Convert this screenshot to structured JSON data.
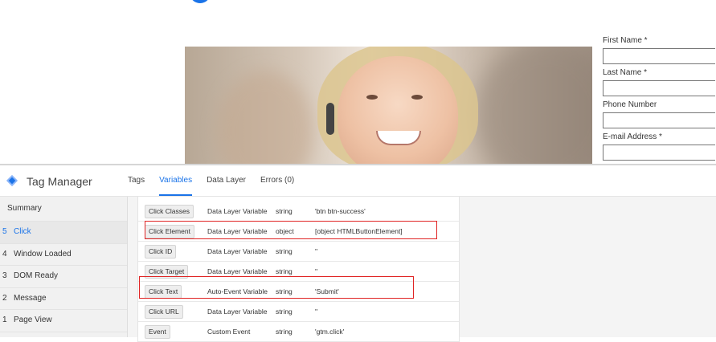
{
  "website": {
    "form": {
      "fields": [
        {
          "label": "First Name *",
          "value": ""
        },
        {
          "label": "Last Name *",
          "value": ""
        },
        {
          "label": "Phone Number",
          "value": ""
        },
        {
          "label": "E-mail Address *",
          "value": ""
        }
      ]
    }
  },
  "gtm": {
    "title": "Tag Manager",
    "tabs": [
      {
        "label": "Tags",
        "active": false
      },
      {
        "label": "Variables",
        "active": true
      },
      {
        "label": "Data Layer",
        "active": false
      },
      {
        "label": "Errors (0)",
        "active": false
      }
    ],
    "sidebar": {
      "summary": "Summary",
      "events": [
        {
          "num": "5",
          "label": "Click",
          "active": true
        },
        {
          "num": "4",
          "label": "Window Loaded",
          "active": false
        },
        {
          "num": "3",
          "label": "DOM Ready",
          "active": false
        },
        {
          "num": "2",
          "label": "Message",
          "active": false
        },
        {
          "num": "1",
          "label": "Page View",
          "active": false
        }
      ]
    },
    "variables": [
      {
        "name": "Click Classes",
        "type": "Data Layer Variable",
        "return_type": "string",
        "value": "'btn btn-success'"
      },
      {
        "name": "Click Element",
        "type": "Data Layer Variable",
        "return_type": "object",
        "value": "[object HTMLButtonElement]"
      },
      {
        "name": "Click ID",
        "type": "Data Layer Variable",
        "return_type": "string",
        "value": "''"
      },
      {
        "name": "Click Target",
        "type": "Data Layer Variable",
        "return_type": "string",
        "value": "''"
      },
      {
        "name": "Click Text",
        "type": "Auto-Event Variable",
        "return_type": "string",
        "value": "'Submit'"
      },
      {
        "name": "Click URL",
        "type": "Data Layer Variable",
        "return_type": "string",
        "value": "''"
      },
      {
        "name": "Event",
        "type": "Custom Event",
        "return_type": "string",
        "value": "'gtm.click'"
      }
    ],
    "highlight_color": "#e02424",
    "accent_color": "#1a73e8"
  }
}
